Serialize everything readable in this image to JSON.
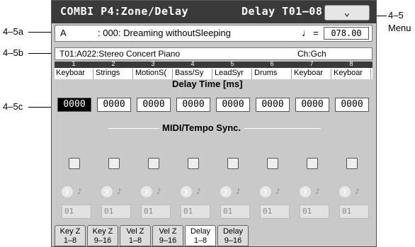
{
  "callouts": {
    "c1": "4–5a",
    "c2": "4–5b",
    "c3": "4–5c",
    "c4": "4–5",
    "c5": "Menu"
  },
  "header": {
    "title": "COMBI P4:Zone/Delay",
    "page": "Delay T01–08",
    "menu_icon": "chevron-down"
  },
  "combi": {
    "bank": "A",
    "name": ": 000: Dreaming withoutSleeping",
    "tempo_symbol": "♩",
    "tempo_eq": "=",
    "tempo": "078.00"
  },
  "program": {
    "text": "T01:A022:Stereo Concert Piano",
    "channel": "Ch:Gch"
  },
  "tracks": [
    {
      "num": "1",
      "name": "Keyboar",
      "delay": "0000",
      "base": "01"
    },
    {
      "num": "2",
      "name": "Strings",
      "delay": "0000",
      "base": "01"
    },
    {
      "num": "3",
      "name": "MotionS(",
      "delay": "0000",
      "base": "01"
    },
    {
      "num": "4",
      "name": "Bass/Sy",
      "delay": "0000",
      "base": "01"
    },
    {
      "num": "5",
      "name": "LeadSyr",
      "delay": "0000",
      "base": "01"
    },
    {
      "num": "6",
      "name": "Drums",
      "delay": "0000",
      "base": "01"
    },
    {
      "num": "7",
      "name": "Keyboar",
      "delay": "0000",
      "base": "01"
    },
    {
      "num": "8",
      "name": "Keyboar",
      "delay": "0000",
      "base": "01"
    }
  ],
  "labels": {
    "delay_time": "Delay Time [ms]",
    "midi_sync": "MIDI/Tempo Sync."
  },
  "icons": {
    "arrow": "right-arrow-icon",
    "note": "eighth-note-icon"
  },
  "tabs": [
    {
      "l1": "Key Z",
      "l2": "1–8"
    },
    {
      "l1": "Key Z",
      "l2": "9–16"
    },
    {
      "l1": "Vel Z",
      "l2": "1–8"
    },
    {
      "l1": "Vel Z",
      "l2": "9–16"
    },
    {
      "l1": "Delay",
      "l2": "1–8"
    },
    {
      "l1": "Delay",
      "l2": "9–16"
    }
  ]
}
